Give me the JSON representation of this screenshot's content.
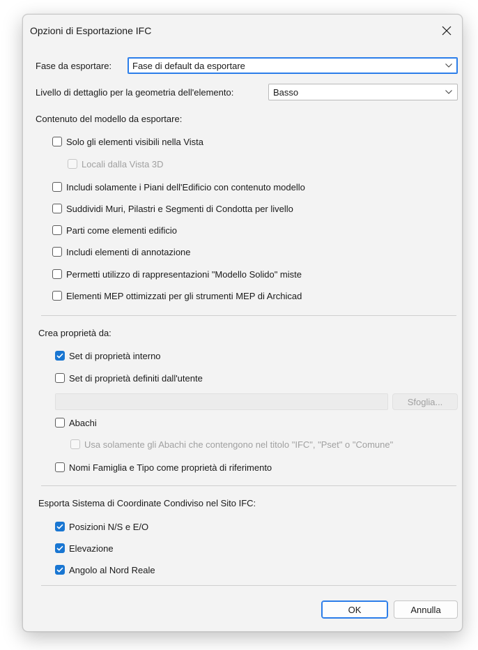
{
  "dialog": {
    "title": "Opzioni di Esportazione IFC"
  },
  "phase": {
    "label": "Fase da esportare:",
    "value": "Fase di default da esportare"
  },
  "detail": {
    "label": "Livello di dettaglio per la geometria dell'elemento:",
    "value": "Basso"
  },
  "model_content": {
    "heading": "Contenuto del modello da esportare:",
    "options": [
      {
        "label": "Solo gli elementi visibili nella Vista",
        "checked": false,
        "disabled": false
      },
      {
        "label": "Locali dalla Vista 3D",
        "checked": false,
        "disabled": true
      },
      {
        "label": "Includi solamente i Piani dell'Edificio con contenuto modello",
        "checked": false,
        "disabled": false
      },
      {
        "label": "Suddividi Muri, Pilastri e Segmenti di Condotta per livello",
        "checked": false,
        "disabled": false
      },
      {
        "label": "Parti come elementi edificio",
        "checked": false,
        "disabled": false
      },
      {
        "label": "Includi elementi di annotazione",
        "checked": false,
        "disabled": false
      },
      {
        "label": "Permetti utilizzo di rappresentazioni \"Modello Solido\" miste",
        "checked": false,
        "disabled": false
      },
      {
        "label": "Elementi MEP ottimizzati per gli strumenti MEP di Archicad",
        "checked": false,
        "disabled": false
      }
    ]
  },
  "properties": {
    "heading": "Crea proprietà da:",
    "internal": {
      "label": "Set di proprietà interno",
      "checked": true
    },
    "user_defined": {
      "label": "Set di proprietà definiti dall'utente",
      "checked": false
    },
    "path_value": "",
    "browse_label": "Sfoglia...",
    "schedules": {
      "label": "Abachi",
      "checked": false
    },
    "schedules_filter": {
      "label": "Usa solamente gli Abachi che contengono nel titolo \"IFC\", \"Pset\" o \"Comune\"",
      "checked": false,
      "disabled": true
    },
    "family_type": {
      "label": "Nomi Famiglia e Tipo come proprietà di riferimento",
      "checked": false
    }
  },
  "coordinates": {
    "heading": "Esporta Sistema di Coordinate Condiviso nel Sito IFC:",
    "options": [
      {
        "label": "Posizioni N/S e E/O",
        "checked": true
      },
      {
        "label": "Elevazione",
        "checked": true
      },
      {
        "label": "Angolo al Nord Reale",
        "checked": true
      }
    ]
  },
  "buttons": {
    "ok": "OK",
    "cancel": "Annulla"
  },
  "colors": {
    "accent": "#1976d2",
    "focus_border": "#2b7de9",
    "dialog_bg": "#f3f3f3"
  },
  "icons": {
    "close": "close-icon",
    "dropdown": "chevron-down-icon",
    "check": "checkmark-icon"
  }
}
